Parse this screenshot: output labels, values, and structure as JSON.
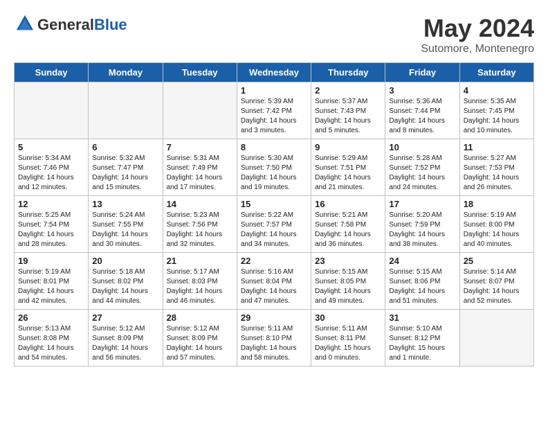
{
  "header": {
    "logo_line1": "General",
    "logo_line2": "Blue",
    "month": "May 2024",
    "location": "Sutomore, Montenegro"
  },
  "days_of_week": [
    "Sunday",
    "Monday",
    "Tuesday",
    "Wednesday",
    "Thursday",
    "Friday",
    "Saturday"
  ],
  "weeks": [
    [
      {
        "day": "",
        "empty": true
      },
      {
        "day": "",
        "empty": true
      },
      {
        "day": "",
        "empty": true
      },
      {
        "day": "1",
        "sunrise": "5:39 AM",
        "sunset": "7:42 PM",
        "daylight": "14 hours and 3 minutes."
      },
      {
        "day": "2",
        "sunrise": "5:37 AM",
        "sunset": "7:43 PM",
        "daylight": "14 hours and 5 minutes."
      },
      {
        "day": "3",
        "sunrise": "5:36 AM",
        "sunset": "7:44 PM",
        "daylight": "14 hours and 8 minutes."
      },
      {
        "day": "4",
        "sunrise": "5:35 AM",
        "sunset": "7:45 PM",
        "daylight": "14 hours and 10 minutes."
      }
    ],
    [
      {
        "day": "5",
        "sunrise": "5:34 AM",
        "sunset": "7:46 PM",
        "daylight": "14 hours and 12 minutes."
      },
      {
        "day": "6",
        "sunrise": "5:32 AM",
        "sunset": "7:47 PM",
        "daylight": "14 hours and 15 minutes."
      },
      {
        "day": "7",
        "sunrise": "5:31 AM",
        "sunset": "7:49 PM",
        "daylight": "14 hours and 17 minutes."
      },
      {
        "day": "8",
        "sunrise": "5:30 AM",
        "sunset": "7:50 PM",
        "daylight": "14 hours and 19 minutes."
      },
      {
        "day": "9",
        "sunrise": "5:29 AM",
        "sunset": "7:51 PM",
        "daylight": "14 hours and 21 minutes."
      },
      {
        "day": "10",
        "sunrise": "5:28 AM",
        "sunset": "7:52 PM",
        "daylight": "14 hours and 24 minutes."
      },
      {
        "day": "11",
        "sunrise": "5:27 AM",
        "sunset": "7:53 PM",
        "daylight": "14 hours and 26 minutes."
      }
    ],
    [
      {
        "day": "12",
        "sunrise": "5:25 AM",
        "sunset": "7:54 PM",
        "daylight": "14 hours and 28 minutes."
      },
      {
        "day": "13",
        "sunrise": "5:24 AM",
        "sunset": "7:55 PM",
        "daylight": "14 hours and 30 minutes."
      },
      {
        "day": "14",
        "sunrise": "5:23 AM",
        "sunset": "7:56 PM",
        "daylight": "14 hours and 32 minutes."
      },
      {
        "day": "15",
        "sunrise": "5:22 AM",
        "sunset": "7:57 PM",
        "daylight": "14 hours and 34 minutes."
      },
      {
        "day": "16",
        "sunrise": "5:21 AM",
        "sunset": "7:58 PM",
        "daylight": "14 hours and 36 minutes."
      },
      {
        "day": "17",
        "sunrise": "5:20 AM",
        "sunset": "7:59 PM",
        "daylight": "14 hours and 38 minutes."
      },
      {
        "day": "18",
        "sunrise": "5:19 AM",
        "sunset": "8:00 PM",
        "daylight": "14 hours and 40 minutes."
      }
    ],
    [
      {
        "day": "19",
        "sunrise": "5:19 AM",
        "sunset": "8:01 PM",
        "daylight": "14 hours and 42 minutes."
      },
      {
        "day": "20",
        "sunrise": "5:18 AM",
        "sunset": "8:02 PM",
        "daylight": "14 hours and 44 minutes."
      },
      {
        "day": "21",
        "sunrise": "5:17 AM",
        "sunset": "8:03 PM",
        "daylight": "14 hours and 46 minutes."
      },
      {
        "day": "22",
        "sunrise": "5:16 AM",
        "sunset": "8:04 PM",
        "daylight": "14 hours and 47 minutes."
      },
      {
        "day": "23",
        "sunrise": "5:15 AM",
        "sunset": "8:05 PM",
        "daylight": "14 hours and 49 minutes."
      },
      {
        "day": "24",
        "sunrise": "5:15 AM",
        "sunset": "8:06 PM",
        "daylight": "14 hours and 51 minutes."
      },
      {
        "day": "25",
        "sunrise": "5:14 AM",
        "sunset": "8:07 PM",
        "daylight": "14 hours and 52 minutes."
      }
    ],
    [
      {
        "day": "26",
        "sunrise": "5:13 AM",
        "sunset": "8:08 PM",
        "daylight": "14 hours and 54 minutes."
      },
      {
        "day": "27",
        "sunrise": "5:12 AM",
        "sunset": "8:09 PM",
        "daylight": "14 hours and 56 minutes."
      },
      {
        "day": "28",
        "sunrise": "5:12 AM",
        "sunset": "8:09 PM",
        "daylight": "14 hours and 57 minutes."
      },
      {
        "day": "29",
        "sunrise": "5:11 AM",
        "sunset": "8:10 PM",
        "daylight": "14 hours and 58 minutes."
      },
      {
        "day": "30",
        "sunrise": "5:11 AM",
        "sunset": "8:11 PM",
        "daylight": "15 hours and 0 minutes."
      },
      {
        "day": "31",
        "sunrise": "5:10 AM",
        "sunset": "8:12 PM",
        "daylight": "15 hours and 1 minute."
      },
      {
        "day": "",
        "empty": true
      }
    ]
  ]
}
